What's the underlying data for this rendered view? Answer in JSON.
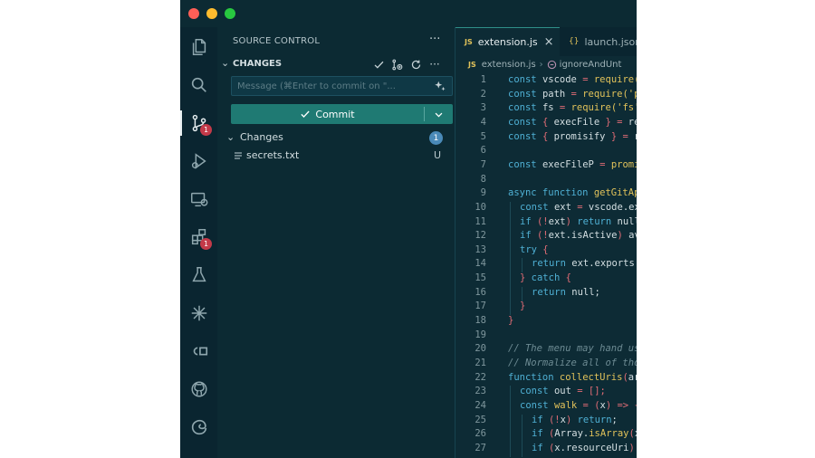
{
  "sidebar": {
    "title": "SOURCE CONTROL",
    "more": "···",
    "changes_header": "CHANGES",
    "message_placeholder": "Message (⌘Enter to commit on \"...",
    "commit_label": "Commit",
    "group_label": "Changes",
    "group_count": "1",
    "file": {
      "name": "secrets.txt",
      "status": "U"
    }
  },
  "activity": {
    "source_control_badge": "1",
    "extensions_badge": "1"
  },
  "tabs": {
    "active": "extension.js",
    "inactive": "launch.json",
    "js_icon": "JS",
    "brace_icon": "{}"
  },
  "breadcrumb": {
    "file": "extension.js",
    "symbol": "ignoreAndUnt"
  },
  "code_lines": [
    {
      "n": "1",
      "indent": 0,
      "parts": [
        [
          "kw",
          "const "
        ],
        [
          "var",
          "vscode "
        ],
        [
          "pun",
          "= "
        ],
        [
          "fn",
          "require("
        ]
      ]
    },
    {
      "n": "2",
      "indent": 0,
      "parts": [
        [
          "kw",
          "const "
        ],
        [
          "var",
          "path "
        ],
        [
          "pun",
          "= "
        ],
        [
          "fn",
          "require("
        ],
        [
          "str",
          "'p"
        ]
      ]
    },
    {
      "n": "3",
      "indent": 0,
      "parts": [
        [
          "kw",
          "const "
        ],
        [
          "var",
          "fs "
        ],
        [
          "pun",
          "= "
        ],
        [
          "fn",
          "require("
        ],
        [
          "str",
          "'fs'"
        ]
      ]
    },
    {
      "n": "4",
      "indent": 0,
      "parts": [
        [
          "kw",
          "const "
        ],
        [
          "pun",
          "{ "
        ],
        [
          "var",
          "execFile "
        ],
        [
          "pun",
          "} = "
        ],
        [
          "var",
          "re"
        ]
      ]
    },
    {
      "n": "5",
      "indent": 0,
      "parts": [
        [
          "kw",
          "const "
        ],
        [
          "pun",
          "{ "
        ],
        [
          "var",
          "promisify "
        ],
        [
          "pun",
          "} = "
        ],
        [
          "var",
          "r"
        ]
      ]
    },
    {
      "n": "6",
      "indent": 0,
      "parts": []
    },
    {
      "n": "7",
      "indent": 0,
      "parts": [
        [
          "kw",
          "const "
        ],
        [
          "var",
          "execFileP "
        ],
        [
          "pun",
          "= "
        ],
        [
          "fn",
          "promi"
        ]
      ]
    },
    {
      "n": "8",
      "indent": 0,
      "parts": []
    },
    {
      "n": "9",
      "indent": 0,
      "parts": [
        [
          "kw",
          "async function "
        ],
        [
          "fn",
          "getGitAp"
        ]
      ]
    },
    {
      "n": "10",
      "indent": 1,
      "parts": [
        [
          "kw",
          "const "
        ],
        [
          "var",
          "ext "
        ],
        [
          "pun",
          "= "
        ],
        [
          "var",
          "vscode.ex"
        ]
      ]
    },
    {
      "n": "11",
      "indent": 1,
      "parts": [
        [
          "kw",
          "if "
        ],
        [
          "pun",
          "(!"
        ],
        [
          "var",
          "ext"
        ],
        [
          "pun",
          ") "
        ],
        [
          "kw",
          "return "
        ],
        [
          "var",
          "null"
        ]
      ]
    },
    {
      "n": "12",
      "indent": 1,
      "parts": [
        [
          "kw",
          "if "
        ],
        [
          "pun",
          "(!"
        ],
        [
          "var",
          "ext.isActive"
        ],
        [
          "pun",
          ") "
        ],
        [
          "var",
          "av"
        ]
      ]
    },
    {
      "n": "13",
      "indent": 1,
      "parts": [
        [
          "kw",
          "try "
        ],
        [
          "pun",
          "{"
        ]
      ]
    },
    {
      "n": "14",
      "indent": 2,
      "parts": [
        [
          "kw",
          "return "
        ],
        [
          "var",
          "ext.exports."
        ]
      ]
    },
    {
      "n": "15",
      "indent": 1,
      "parts": [
        [
          "pun",
          "} "
        ],
        [
          "kw",
          "catch "
        ],
        [
          "pun",
          "{"
        ]
      ]
    },
    {
      "n": "16",
      "indent": 2,
      "parts": [
        [
          "kw",
          "return "
        ],
        [
          "var",
          "null;"
        ]
      ]
    },
    {
      "n": "17",
      "indent": 1,
      "parts": [
        [
          "pun",
          "}"
        ]
      ]
    },
    {
      "n": "18",
      "indent": 0,
      "parts": [
        [
          "pun",
          "}"
        ]
      ]
    },
    {
      "n": "19",
      "indent": 0,
      "parts": []
    },
    {
      "n": "20",
      "indent": 0,
      "parts": [
        [
          "cm",
          "// The menu may hand us"
        ]
      ]
    },
    {
      "n": "21",
      "indent": 0,
      "parts": [
        [
          "cm",
          "// Normalize all of tho"
        ]
      ]
    },
    {
      "n": "22",
      "indent": 0,
      "parts": [
        [
          "kw",
          "function "
        ],
        [
          "fn",
          "collectUris"
        ],
        [
          "pun",
          "("
        ],
        [
          "var",
          "ar"
        ]
      ]
    },
    {
      "n": "23",
      "indent": 1,
      "parts": [
        [
          "kw",
          "const "
        ],
        [
          "var",
          "out "
        ],
        [
          "pun",
          "= [];"
        ]
      ]
    },
    {
      "n": "24",
      "indent": 1,
      "parts": [
        [
          "kw",
          "const "
        ],
        [
          "fn",
          "walk "
        ],
        [
          "pun",
          "= ("
        ],
        [
          "var",
          "x"
        ],
        [
          "pun",
          ") => {"
        ]
      ]
    },
    {
      "n": "25",
      "indent": 2,
      "parts": [
        [
          "kw",
          "if "
        ],
        [
          "pun",
          "(!"
        ],
        [
          "var",
          "x"
        ],
        [
          "pun",
          ") "
        ],
        [
          "kw",
          "return"
        ],
        [
          "var",
          ";"
        ]
      ]
    },
    {
      "n": "26",
      "indent": 2,
      "parts": [
        [
          "kw",
          "if "
        ],
        [
          "pun",
          "("
        ],
        [
          "var",
          "Array."
        ],
        [
          "fn",
          "isArray"
        ],
        [
          "pun",
          "("
        ],
        [
          "var",
          "x"
        ]
      ]
    },
    {
      "n": "27",
      "indent": 2,
      "parts": [
        [
          "kw",
          "if "
        ],
        [
          "pun",
          "("
        ],
        [
          "var",
          "x.resourceUri"
        ],
        [
          "pun",
          ")"
        ]
      ]
    }
  ]
}
